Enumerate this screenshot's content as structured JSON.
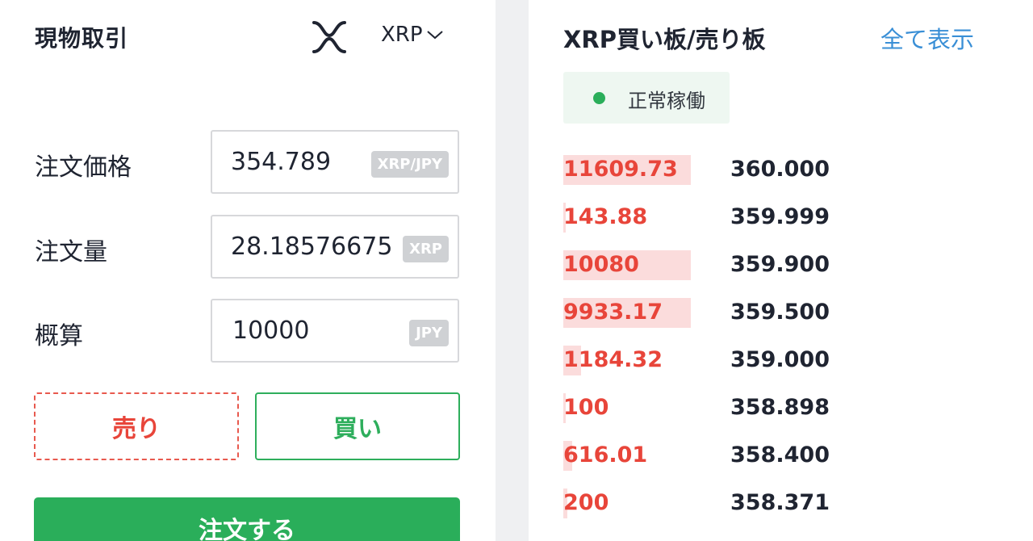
{
  "trade": {
    "title": "現物取引",
    "coin_icon": "xrp-logo-icon",
    "coin": "XRP",
    "fields": [
      {
        "label": "注文価格",
        "value": "354.789",
        "unit": "XRP/JPY"
      },
      {
        "label": "注文量",
        "value": "28.18576675",
        "unit": "XRP"
      },
      {
        "label": "概算",
        "value": "10000",
        "unit": "JPY"
      }
    ],
    "sell_label": "売り",
    "buy_label": "買い",
    "order_label": "注文する"
  },
  "orderbook": {
    "title": "XRP買い板/売り板",
    "show_all": "全て表示",
    "status": "正常稼働",
    "rows": [
      {
        "qty": "11609.73",
        "price": "360.000",
        "depth": 1.0
      },
      {
        "qty": "143.88",
        "price": "359.999",
        "depth": 0.02
      },
      {
        "qty": "10080",
        "price": "359.900",
        "depth": 1.0
      },
      {
        "qty": "9933.17",
        "price": "359.500",
        "depth": 1.0
      },
      {
        "qty": "1184.32",
        "price": "359.000",
        "depth": 0.14
      },
      {
        "qty": "100",
        "price": "358.898",
        "depth": 0.02
      },
      {
        "qty": "616.01",
        "price": "358.400",
        "depth": 0.07
      },
      {
        "qty": "200",
        "price": "358.371",
        "depth": 0.03
      }
    ]
  },
  "colors": {
    "accent_green": "#2aae5a",
    "sell_red": "#e8453a",
    "link_blue": "#3a8fd6",
    "depth_bar": "#fbdcdc"
  }
}
